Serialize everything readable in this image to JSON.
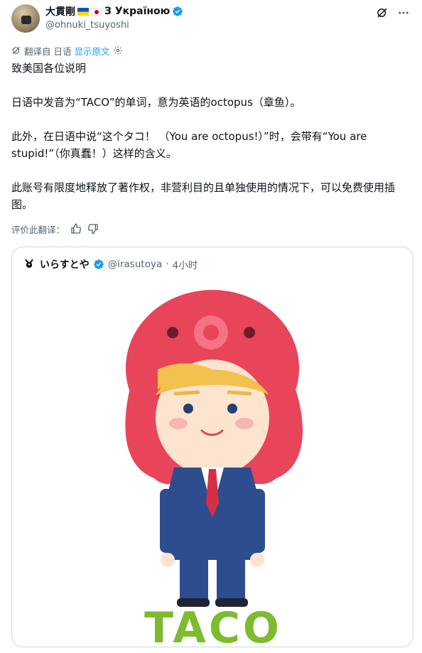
{
  "author": {
    "display_name": "大貫剛",
    "name_suffix": "З Україною",
    "handle": "@ohnuki_tsuyoshi"
  },
  "translation_bar": {
    "label": "翻译自 日语",
    "show_original": "显示原文"
  },
  "tweet": {
    "paragraphs": [
      "致美国各位说明",
      "日语中发音为“TACO”的单词，意为英语的octopus（章鱼）。",
      "此外，在日语中说“这个タコ！ （You are octopus!）”时，会带有“You are stupid!”（你真蠢！）这样的含义。",
      "此账号有限度地释放了著作权，非营利目的且单独使用的情况下，可以免费使用插图。"
    ]
  },
  "rate_translation": {
    "label": "评价此翻译："
  },
  "quote": {
    "name": "いらすとや",
    "handle": "@irasutoya",
    "separator": "·",
    "time": "4小时"
  },
  "illustration": {
    "caption": "TACO",
    "colors": {
      "octopus": "#e8445a",
      "hair": "#f2c14e",
      "suit": "#2e4d8f",
      "tie": "#d62f45",
      "text": "#7dbb2f"
    }
  },
  "colors": {
    "text": "#0f1419",
    "secondary": "#536471",
    "link": "#1d9bf0",
    "verified": "#1d9bf0",
    "border": "#cfd9de"
  }
}
